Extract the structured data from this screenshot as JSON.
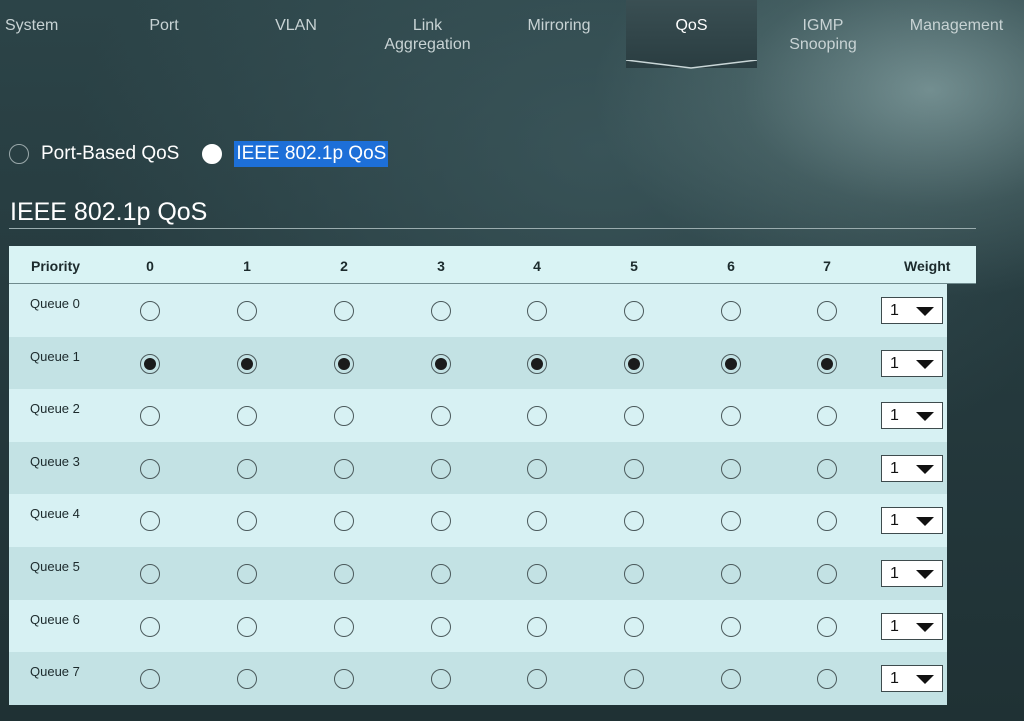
{
  "nav": {
    "tabs": [
      {
        "label": "System",
        "active": false
      },
      {
        "label": "Port",
        "active": false
      },
      {
        "label": "VLAN",
        "active": false
      },
      {
        "label": "Link\nAggregation",
        "active": false
      },
      {
        "label": "Mirroring",
        "active": false
      },
      {
        "label": "QoS",
        "active": true
      },
      {
        "label": "IGMP\nSnooping",
        "active": false
      },
      {
        "label": "Management",
        "active": false
      }
    ]
  },
  "mode": {
    "options": [
      {
        "label": "Port-Based QoS",
        "checked": false
      },
      {
        "label": "IEEE 802.1p QoS",
        "checked": true
      }
    ]
  },
  "section": {
    "title": "IEEE 802.1p QoS"
  },
  "table": {
    "headers": [
      "Priority",
      "0",
      "1",
      "2",
      "3",
      "4",
      "5",
      "6",
      "7",
      "Weight"
    ],
    "rows": [
      {
        "queue": "Queue 0",
        "selected": [
          false,
          false,
          false,
          false,
          false,
          false,
          false,
          false
        ],
        "weight": "1"
      },
      {
        "queue": "Queue 1",
        "selected": [
          true,
          true,
          true,
          true,
          true,
          true,
          true,
          true
        ],
        "weight": "1"
      },
      {
        "queue": "Queue 2",
        "selected": [
          false,
          false,
          false,
          false,
          false,
          false,
          false,
          false
        ],
        "weight": "1"
      },
      {
        "queue": "Queue 3",
        "selected": [
          false,
          false,
          false,
          false,
          false,
          false,
          false,
          false
        ],
        "weight": "1"
      },
      {
        "queue": "Queue 4",
        "selected": [
          false,
          false,
          false,
          false,
          false,
          false,
          false,
          false
        ],
        "weight": "1"
      },
      {
        "queue": "Queue 5",
        "selected": [
          false,
          false,
          false,
          false,
          false,
          false,
          false,
          false
        ],
        "weight": "1"
      },
      {
        "queue": "Queue 6",
        "selected": [
          false,
          false,
          false,
          false,
          false,
          false,
          false,
          false
        ],
        "weight": "1"
      },
      {
        "queue": "Queue 7",
        "selected": [
          false,
          false,
          false,
          false,
          false,
          false,
          false,
          false
        ],
        "weight": "1"
      }
    ]
  },
  "colors": {
    "highlight": "#1d6fd8",
    "row_light": "#d7f1f3",
    "row_dark": "#c3e2e4"
  }
}
